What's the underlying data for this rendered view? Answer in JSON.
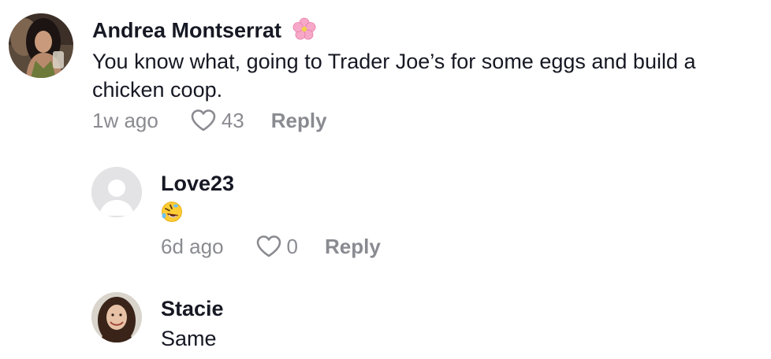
{
  "comments": [
    {
      "author": "Andrea Montserrat",
      "author_badge_icon": "cherry-blossom-icon",
      "text": "You know what, going to Trader Joe’s for some eggs and build a chicken coop.",
      "time": "1w ago",
      "likes": "43",
      "reply_label": "Reply"
    },
    {
      "author": "Love23",
      "text": "🤣",
      "time": "6d ago",
      "likes": "0",
      "reply_label": "Reply"
    },
    {
      "author": "Stacie",
      "text": "Same"
    }
  ],
  "colors": {
    "text": "#161823",
    "meta": "#8a8b91",
    "badge_pink": "#f7a8c8"
  }
}
